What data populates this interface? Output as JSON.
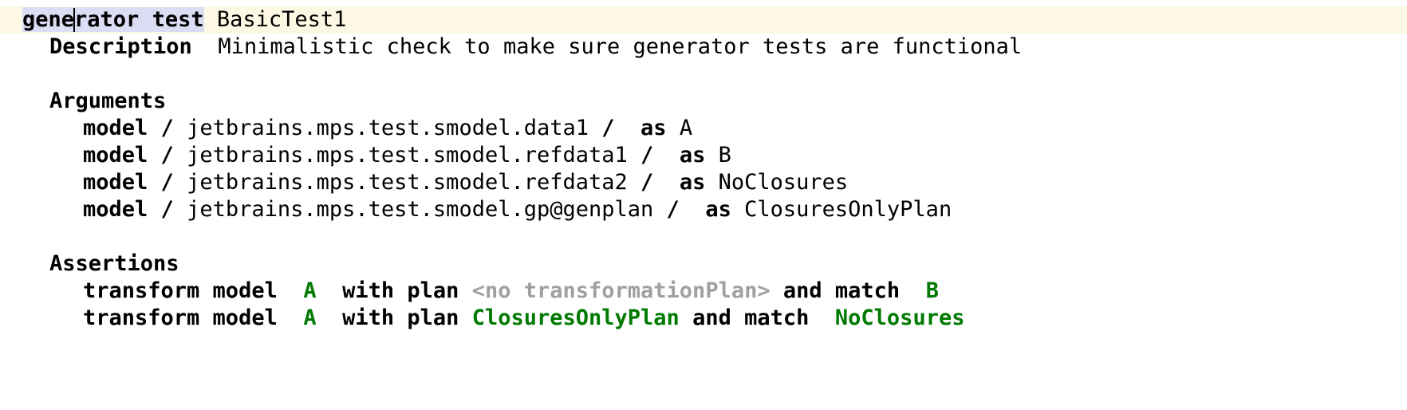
{
  "editor": {
    "colors": {
      "current_line_background": "#fdf8e3",
      "selection_background": "#dcdcf5",
      "reference_green": "#007a00",
      "placeholder_gray": "#a0a0a0",
      "text_black": "#000000",
      "canvas_white": "#ffffff"
    }
  },
  "header": {
    "concept_keyword": "generator test",
    "concept_keyword_before_caret": "gene",
    "concept_keyword_after_caret": "rator test",
    "node_name": "BasicTest1"
  },
  "description": {
    "label": "Description",
    "value": "Minimalistic check to make sure generator tests are functional"
  },
  "arguments": {
    "label": "Arguments",
    "items": [
      {
        "keyword": "model",
        "separator_left": "/",
        "model_ref": "jetbrains.mps.test.smodel.data1",
        "separator_right": "/",
        "as_keyword": "as",
        "alias": "A"
      },
      {
        "keyword": "model",
        "separator_left": "/",
        "model_ref": "jetbrains.mps.test.smodel.refdata1",
        "separator_right": "/",
        "as_keyword": "as",
        "alias": "B"
      },
      {
        "keyword": "model",
        "separator_left": "/",
        "model_ref": "jetbrains.mps.test.smodel.refdata2",
        "separator_right": "/",
        "as_keyword": "as",
        "alias": "NoClosures"
      },
      {
        "keyword": "model",
        "separator_left": "/",
        "model_ref": "jetbrains.mps.test.smodel.gp@genplan",
        "separator_right": "/",
        "as_keyword": "as",
        "alias": "ClosuresOnlyPlan"
      }
    ]
  },
  "assertions": {
    "label": "Assertions",
    "items": [
      {
        "transform_keyword": "transform model",
        "model_ref": "A",
        "with_plan_keyword": "with plan",
        "plan_ref": "<no transformationPlan>",
        "plan_is_placeholder": true,
        "and_match_keyword": "and match",
        "match_ref": "B"
      },
      {
        "transform_keyword": "transform model",
        "model_ref": "A",
        "with_plan_keyword": "with plan",
        "plan_ref": "ClosuresOnlyPlan",
        "plan_is_placeholder": false,
        "and_match_keyword": "and match",
        "match_ref": "NoClosures"
      }
    ]
  }
}
